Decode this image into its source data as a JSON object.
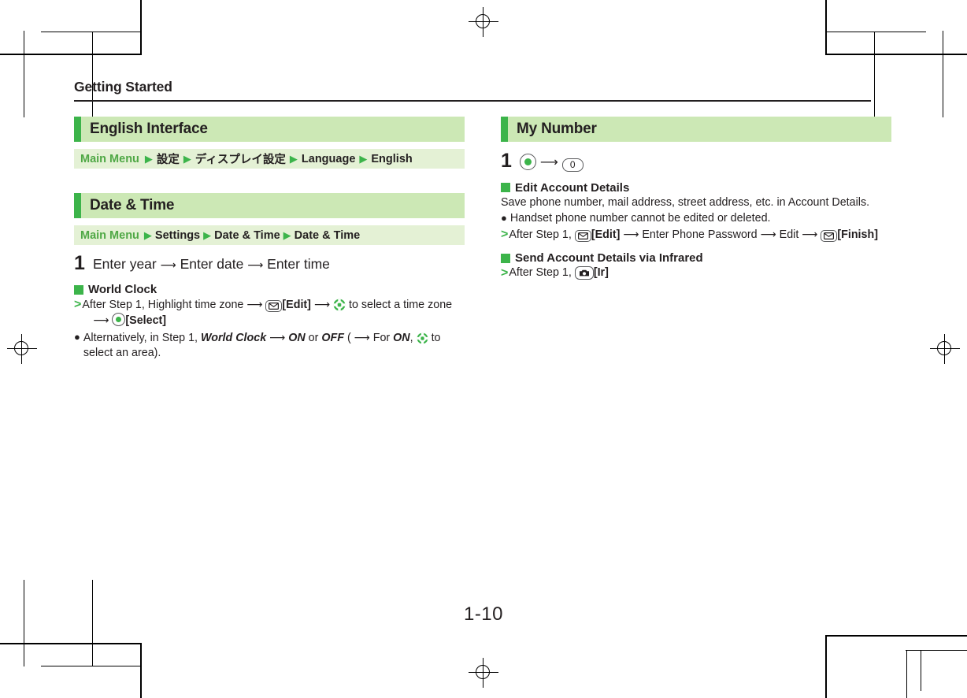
{
  "page": {
    "running_head": "Getting Started",
    "page_number": "1-10"
  },
  "left_column": {
    "sections": [
      {
        "title": "English Interface",
        "path": {
          "main_menu": "Main Menu",
          "segments": [
            "設定",
            "ディスプレイ設定",
            "Language",
            "English"
          ]
        }
      },
      {
        "title": "Date & Time",
        "path": {
          "main_menu": "Main Menu",
          "segments": [
            "Settings",
            "Date & Time",
            "Date & Time"
          ]
        },
        "step": {
          "number": "1",
          "text_1": "Enter year",
          "text_2": "Enter date",
          "text_3": "Enter time"
        },
        "sub_sections": [
          {
            "heading": "World Clock",
            "line_gt_1": "After Step 1, Highlight time zone",
            "line_gt_2": "[Edit]",
            "line_gt_3": "to select a time zone",
            "line_gt_4": "[Select]",
            "bullet_1a": "Alternatively, in Step 1,",
            "bullet_1b": "World Clock",
            "bullet_1c": "ON",
            "bullet_1d": "or",
            "bullet_1e": "OFF",
            "bullet_1f": "( ",
            "bullet_1g": "For",
            "bullet_1h": "ON",
            "bullet_1i": ",",
            "bullet_1j": "to select an area)."
          }
        ]
      }
    ]
  },
  "right_column": {
    "sections": [
      {
        "title": "My Number",
        "step": {
          "number": "1",
          "key_0_label": "0"
        },
        "sub_sections": [
          {
            "heading": "Edit Account Details",
            "para_1": "Save phone number, mail address, street address, etc. in Account Details.",
            "bullet_1": "Handset phone number cannot be edited or deleted.",
            "line_gt_1": "After Step 1,",
            "line_gt_2": "[Edit]",
            "line_gt_3": "Enter Phone Password",
            "line_gt_4": "Edit",
            "line_gt_5": "[Finish]"
          },
          {
            "heading": "Send Account Details via Infrared",
            "line_gt_1": "After Step 1,",
            "line_gt_2": "[Ir]"
          }
        ]
      }
    ]
  },
  "colors": {
    "accent_green": "#3cb44a",
    "header_bg": "#cce8b5",
    "path_bg": "#e4f1d5",
    "path_label_green": "#4fa845",
    "text": "#231f20"
  }
}
